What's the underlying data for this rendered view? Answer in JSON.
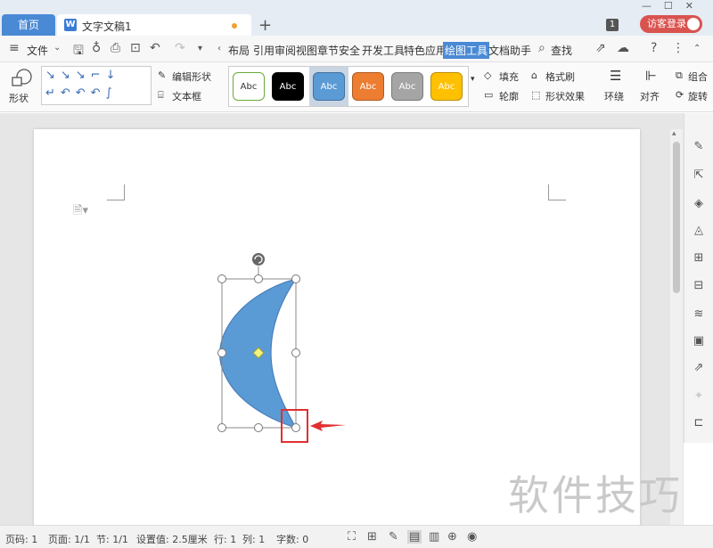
{
  "titlebar": {
    "home_tab": "首页",
    "doc_tab": "文字文稿1",
    "new_tab": "+",
    "window_count": "1",
    "visitor_login": "访客登录"
  },
  "menu": {
    "file": "文件",
    "tabs": [
      "布局",
      "引用",
      "审阅",
      "视图",
      "章节",
      "安全",
      "开发工具",
      "特色应用",
      "绘图工具",
      "文档助手"
    ],
    "active_tab": "绘图工具",
    "search": "查找"
  },
  "ribbon": {
    "shape": "形状",
    "edit_shape": "编辑形状",
    "textbox": "文本框",
    "style_swatches": [
      {
        "label": "Abc",
        "bg": "#ffffff",
        "fg": "#333333",
        "border": "#6aaa3a"
      },
      {
        "label": "Abc",
        "bg": "#000000",
        "fg": "#ffffff",
        "border": "#000000"
      },
      {
        "label": "Abc",
        "bg": "#5b9bd5",
        "fg": "#ffffff",
        "border": "#41719c"
      },
      {
        "label": "Abc",
        "bg": "#ed7d31",
        "fg": "#ffffff",
        "border": "#ae5a21"
      },
      {
        "label": "Abc",
        "bg": "#a5a5a5",
        "fg": "#ffffff",
        "border": "#7b7b7b"
      },
      {
        "label": "Abc",
        "bg": "#ffc000",
        "fg": "#ffffff",
        "border": "#bc8c00"
      }
    ],
    "fill": "填充",
    "format_painter": "格式刷",
    "outline": "轮廓",
    "shape_effects": "形状效果",
    "wrap": "环绕",
    "align": "对齐",
    "group": "组合",
    "rotate": "旋转"
  },
  "shape": {
    "type": "moon",
    "fill_color": "#5b9bd5",
    "outline_color": "#4a7ebb",
    "selected": true,
    "callout_color": "#e03030"
  },
  "status": {
    "page_num": "页码: 1",
    "pages": "页面: 1/1",
    "section": "节: 1/1",
    "position": "设置值: 2.5厘米",
    "row": "行: 1",
    "col": "列: 1",
    "word_count": "字数: 0"
  },
  "watermark": "软件技巧"
}
